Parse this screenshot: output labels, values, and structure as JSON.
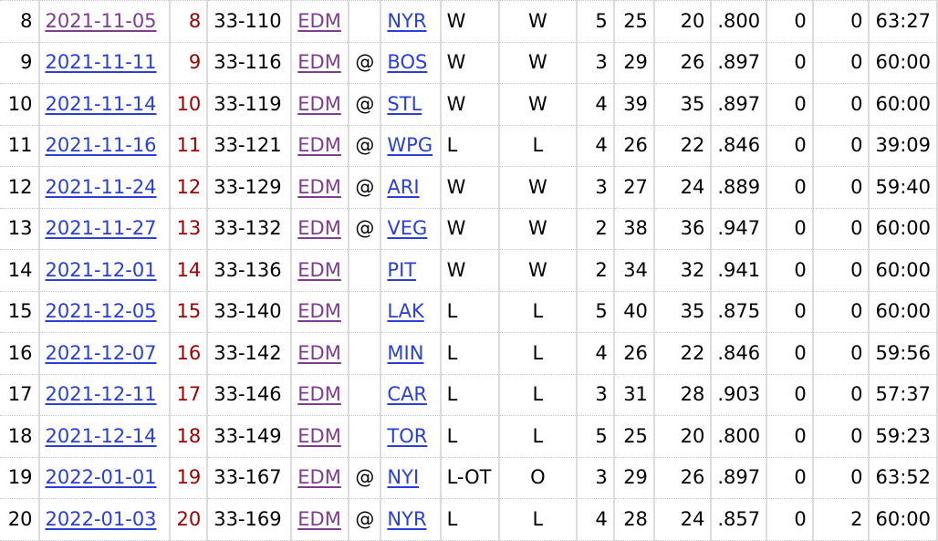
{
  "colors": {
    "link": "#2b3fd6",
    "visited_link": "#7d3f8c",
    "game_number": "#9b0000"
  },
  "rows": [
    {
      "rk": "8",
      "date": "2021-11-05",
      "date_visited": true,
      "gp": "8",
      "age": "33-110",
      "team": "EDM",
      "loc": "",
      "opp": "NYR",
      "result": "W",
      "decision": "W",
      "ga": "5",
      "sa": "25",
      "sv": "20",
      "svp": ".800",
      "so": "0",
      "pim": "0",
      "toi": "63:27"
    },
    {
      "rk": "9",
      "date": "2021-11-11",
      "date_visited": false,
      "gp": "9",
      "age": "33-116",
      "team": "EDM",
      "loc": "@",
      "opp": "BOS",
      "result": "W",
      "decision": "W",
      "ga": "3",
      "sa": "29",
      "sv": "26",
      "svp": ".897",
      "so": "0",
      "pim": "0",
      "toi": "60:00"
    },
    {
      "rk": "10",
      "date": "2021-11-14",
      "date_visited": false,
      "gp": "10",
      "age": "33-119",
      "team": "EDM",
      "loc": "@",
      "opp": "STL",
      "result": "W",
      "decision": "W",
      "ga": "4",
      "sa": "39",
      "sv": "35",
      "svp": ".897",
      "so": "0",
      "pim": "0",
      "toi": "60:00"
    },
    {
      "rk": "11",
      "date": "2021-11-16",
      "date_visited": false,
      "gp": "11",
      "age": "33-121",
      "team": "EDM",
      "loc": "@",
      "opp": "WPG",
      "result": "L",
      "decision": "L",
      "ga": "4",
      "sa": "26",
      "sv": "22",
      "svp": ".846",
      "so": "0",
      "pim": "0",
      "toi": "39:09"
    },
    {
      "rk": "12",
      "date": "2021-11-24",
      "date_visited": false,
      "gp": "12",
      "age": "33-129",
      "team": "EDM",
      "loc": "@",
      "opp": "ARI",
      "result": "W",
      "decision": "W",
      "ga": "3",
      "sa": "27",
      "sv": "24",
      "svp": ".889",
      "so": "0",
      "pim": "0",
      "toi": "59:40"
    },
    {
      "rk": "13",
      "date": "2021-11-27",
      "date_visited": false,
      "gp": "13",
      "age": "33-132",
      "team": "EDM",
      "loc": "@",
      "opp": "VEG",
      "result": "W",
      "decision": "W",
      "ga": "2",
      "sa": "38",
      "sv": "36",
      "svp": ".947",
      "so": "0",
      "pim": "0",
      "toi": "60:00"
    },
    {
      "rk": "14",
      "date": "2021-12-01",
      "date_visited": false,
      "gp": "14",
      "age": "33-136",
      "team": "EDM",
      "loc": "",
      "opp": "PIT",
      "result": "W",
      "decision": "W",
      "ga": "2",
      "sa": "34",
      "sv": "32",
      "svp": ".941",
      "so": "0",
      "pim": "0",
      "toi": "60:00"
    },
    {
      "rk": "15",
      "date": "2021-12-05",
      "date_visited": false,
      "gp": "15",
      "age": "33-140",
      "team": "EDM",
      "loc": "",
      "opp": "LAK",
      "result": "L",
      "decision": "L",
      "ga": "5",
      "sa": "40",
      "sv": "35",
      "svp": ".875",
      "so": "0",
      "pim": "0",
      "toi": "60:00"
    },
    {
      "rk": "16",
      "date": "2021-12-07",
      "date_visited": false,
      "gp": "16",
      "age": "33-142",
      "team": "EDM",
      "loc": "",
      "opp": "MIN",
      "result": "L",
      "decision": "L",
      "ga": "4",
      "sa": "26",
      "sv": "22",
      "svp": ".846",
      "so": "0",
      "pim": "0",
      "toi": "59:56"
    },
    {
      "rk": "17",
      "date": "2021-12-11",
      "date_visited": false,
      "gp": "17",
      "age": "33-146",
      "team": "EDM",
      "loc": "",
      "opp": "CAR",
      "result": "L",
      "decision": "L",
      "ga": "3",
      "sa": "31",
      "sv": "28",
      "svp": ".903",
      "so": "0",
      "pim": "0",
      "toi": "57:37"
    },
    {
      "rk": "18",
      "date": "2021-12-14",
      "date_visited": false,
      "gp": "18",
      "age": "33-149",
      "team": "EDM",
      "loc": "",
      "opp": "TOR",
      "result": "L",
      "decision": "L",
      "ga": "5",
      "sa": "25",
      "sv": "20",
      "svp": ".800",
      "so": "0",
      "pim": "0",
      "toi": "59:23"
    },
    {
      "rk": "19",
      "date": "2022-01-01",
      "date_visited": false,
      "gp": "19",
      "age": "33-167",
      "team": "EDM",
      "loc": "@",
      "opp": "NYI",
      "result": "L-OT",
      "decision": "O",
      "ga": "3",
      "sa": "29",
      "sv": "26",
      "svp": ".897",
      "so": "0",
      "pim": "0",
      "toi": "63:52"
    },
    {
      "rk": "20",
      "date": "2022-01-03",
      "date_visited": false,
      "gp": "20",
      "age": "33-169",
      "team": "EDM",
      "loc": "@",
      "opp": "NYR",
      "result": "L",
      "decision": "L",
      "ga": "4",
      "sa": "28",
      "sv": "24",
      "svp": ".857",
      "so": "0",
      "pim": "2",
      "toi": "60:00"
    }
  ]
}
